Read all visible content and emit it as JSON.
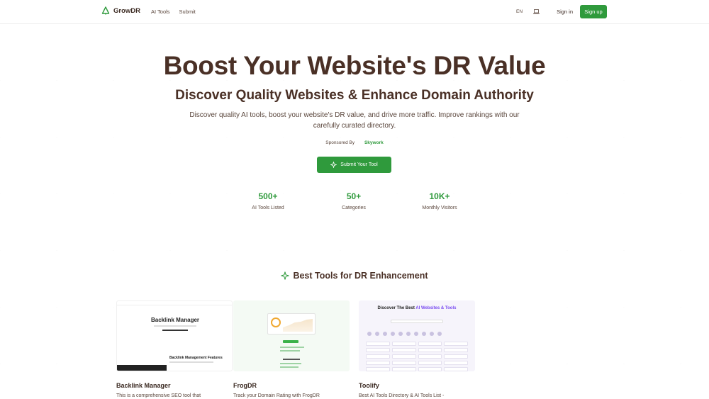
{
  "header": {
    "brand": "GrowDR",
    "nav": [
      "AI Tools",
      "Submit"
    ],
    "lang": "EN",
    "signin": "Sign in",
    "signup": "Sign up"
  },
  "hero": {
    "title": "Boost Your Website's DR Value",
    "subtitle": "Discover Quality Websites & Enhance Domain Authority",
    "description": "Discover quality AI tools, boost your website's DR value, and drive more traffic. Improve rankings with our carefully curated directory.",
    "sponsored_by": "Sponsored By",
    "sponsor": "Skywork",
    "submit_label": "Submit Your Tool"
  },
  "stats": [
    {
      "value": "500+",
      "label": "AI Tools Listed"
    },
    {
      "value": "50+",
      "label": "Categories"
    },
    {
      "value": "10K+",
      "label": "Monthly Visitors"
    }
  ],
  "best_tools": {
    "title": "Best Tools for DR Enhancement",
    "cards": [
      {
        "name": "Backlink Manager",
        "description": "This is a comprehensive SEO tool that",
        "thumb_title": "Backlink Manager",
        "thumb_feature": "Backlink Management Features"
      },
      {
        "name": "FrogDR",
        "description": "Track your Domain Rating with FrogDR"
      },
      {
        "name": "Toolify",
        "description": "Best AI Tools Directory & AI Tools List -",
        "thumb_title_prefix": "Discover The Best",
        "thumb_title_highlight": "AI Websites & Tools"
      }
    ]
  },
  "colors": {
    "accent": "#2f9a3c",
    "heading": "#4a3026"
  },
  "icons": {
    "logo": "tree-icon",
    "theme": "laptop-icon",
    "submit": "sparkle-icon",
    "section": "sparkle-icon"
  }
}
